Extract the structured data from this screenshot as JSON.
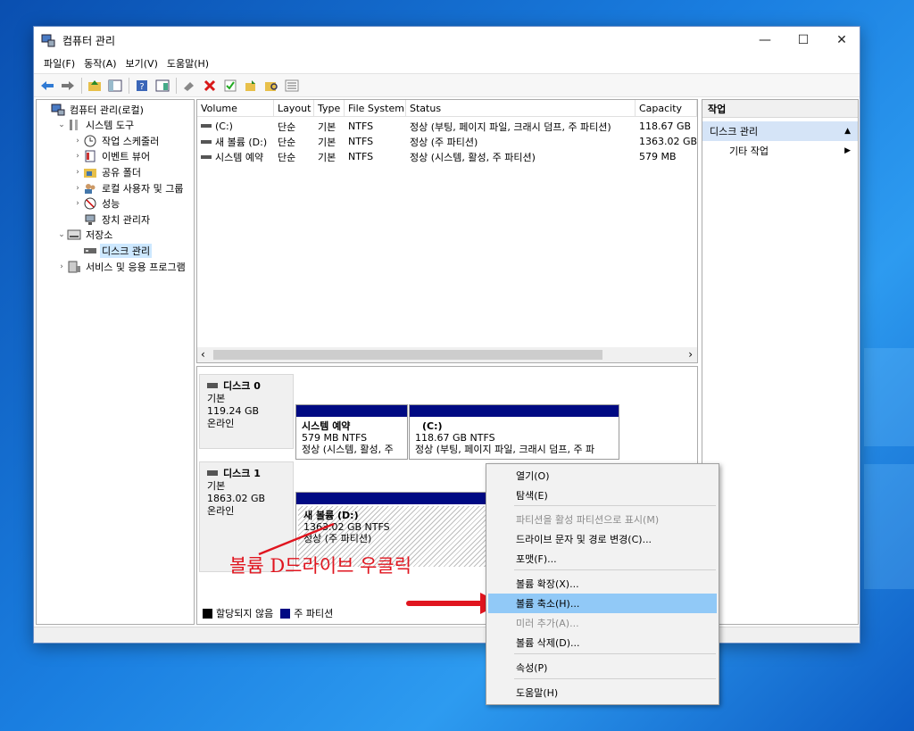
{
  "window": {
    "title": "컴퓨터 관리",
    "minimize": "—",
    "maximize": "☐",
    "close": "✕"
  },
  "menu": [
    "파일(F)",
    "동작(A)",
    "보기(V)",
    "도움말(H)"
  ],
  "tree": [
    {
      "label": "컴퓨터 관리(로컬)",
      "icon": "computer-management-icon",
      "level": 0,
      "expander": ""
    },
    {
      "label": "시스템 도구",
      "icon": "tools-icon",
      "level": 1,
      "expander": "⌄"
    },
    {
      "label": "작업 스케줄러",
      "icon": "clock-icon",
      "level": 2,
      "expander": "›"
    },
    {
      "label": "이벤트 뷰어",
      "icon": "event-viewer-icon",
      "level": 2,
      "expander": "›"
    },
    {
      "label": "공유 폴더",
      "icon": "shared-folder-icon",
      "level": 2,
      "expander": "›"
    },
    {
      "label": "로컬 사용자 및 그룹",
      "icon": "users-icon",
      "level": 2,
      "expander": "›"
    },
    {
      "label": "성능",
      "icon": "performance-icon",
      "level": 2,
      "expander": "›"
    },
    {
      "label": "장치 관리자",
      "icon": "device-manager-icon",
      "level": 2,
      "expander": ""
    },
    {
      "label": "저장소",
      "icon": "storage-icon",
      "level": 1,
      "expander": "⌄"
    },
    {
      "label": "디스크 관리",
      "icon": "disk-icon",
      "level": 2,
      "expander": "",
      "selected": true
    },
    {
      "label": "서비스 및 응용 프로그램",
      "icon": "services-icon",
      "level": 1,
      "expander": "›"
    }
  ],
  "volume_list": {
    "headers": [
      "Volume",
      "Layout",
      "Type",
      "File System",
      "Status",
      "Capacity"
    ],
    "rows": [
      [
        "(C:)",
        "단순",
        "기본",
        "NTFS",
        "정상 (부팅, 페이지 파일, 크래시 덤프, 주 파티션)",
        "118.67 GB"
      ],
      [
        "새 볼륨 (D:)",
        "단순",
        "기본",
        "NTFS",
        "정상 (주 파티션)",
        "1363.02 GB"
      ],
      [
        "시스템 예약",
        "단순",
        "기본",
        "NTFS",
        "정상 (시스템, 활성, 주 파티션)",
        "579 MB"
      ]
    ],
    "scroll_left": "‹",
    "scroll_right": "›"
  },
  "disks": [
    {
      "name": "디스크 0",
      "type": "기본",
      "size": "119.24 GB",
      "state": "온라인",
      "partitions": [
        {
          "name": "시스템 예약",
          "detail": "579 MB NTFS",
          "status": "정상 (시스템, 활성, 주"
        },
        {
          "name": "(C:)",
          "detail": "118.67 GB NTFS",
          "status": "정상 (부팅, 페이지 파일, 크래시 덤프, 주 파"
        }
      ]
    },
    {
      "name": "디스크 1",
      "type": "기본",
      "size": "1863.02 GB",
      "state": "온라인",
      "partitions": [
        {
          "name": "새 볼륨 (D:)",
          "detail": "1363.02 GB NTFS",
          "status": "정상 (주 파티션)"
        }
      ]
    }
  ],
  "legend": {
    "unallocated": "할당되지 않음",
    "primary": "주 파티션"
  },
  "actions": {
    "header": "작업",
    "section": "디스크 관리",
    "section_arrow": "▲",
    "item": "기타 작업",
    "item_arrow": "▶"
  },
  "context_menu": {
    "items": [
      "열기(O)",
      "탐색(E)",
      "파티션을 활성 파티션으로 표시(M)",
      "드라이브 문자 및 경로 변경(C)...",
      "포맷(F)...",
      "볼륨 확장(X)...",
      "볼륨 축소(H)...",
      "미러 추가(A)...",
      "볼륨 삭제(D)...",
      "속성(P)",
      "도움말(H)"
    ]
  },
  "annotation": "볼륨 D드라이브 우클릭",
  "colors": {
    "primary_partition": "#000a83",
    "unallocated": "#000000",
    "annotation": "#e0151f",
    "menu_highlight": "#91c9f7"
  }
}
